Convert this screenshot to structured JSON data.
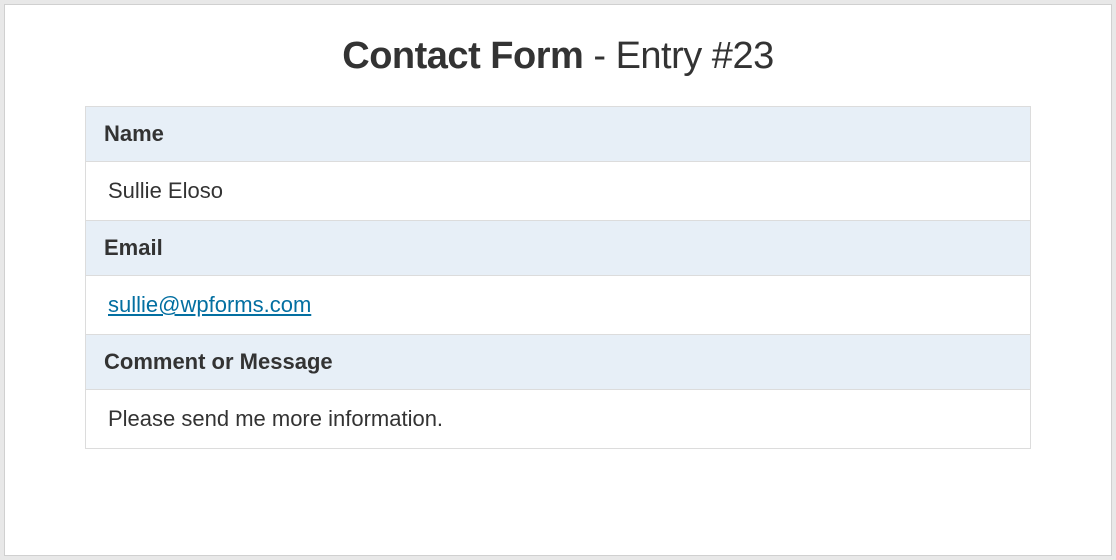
{
  "header": {
    "form_name": "Contact Form",
    "separator": " - ",
    "entry_label": "Entry #23"
  },
  "fields": {
    "name": {
      "label": "Name",
      "value": "Sullie Eloso"
    },
    "email": {
      "label": "Email",
      "value": "sullie@wpforms.com"
    },
    "comment": {
      "label": "Comment or Message",
      "value": "Please send me more information."
    }
  }
}
